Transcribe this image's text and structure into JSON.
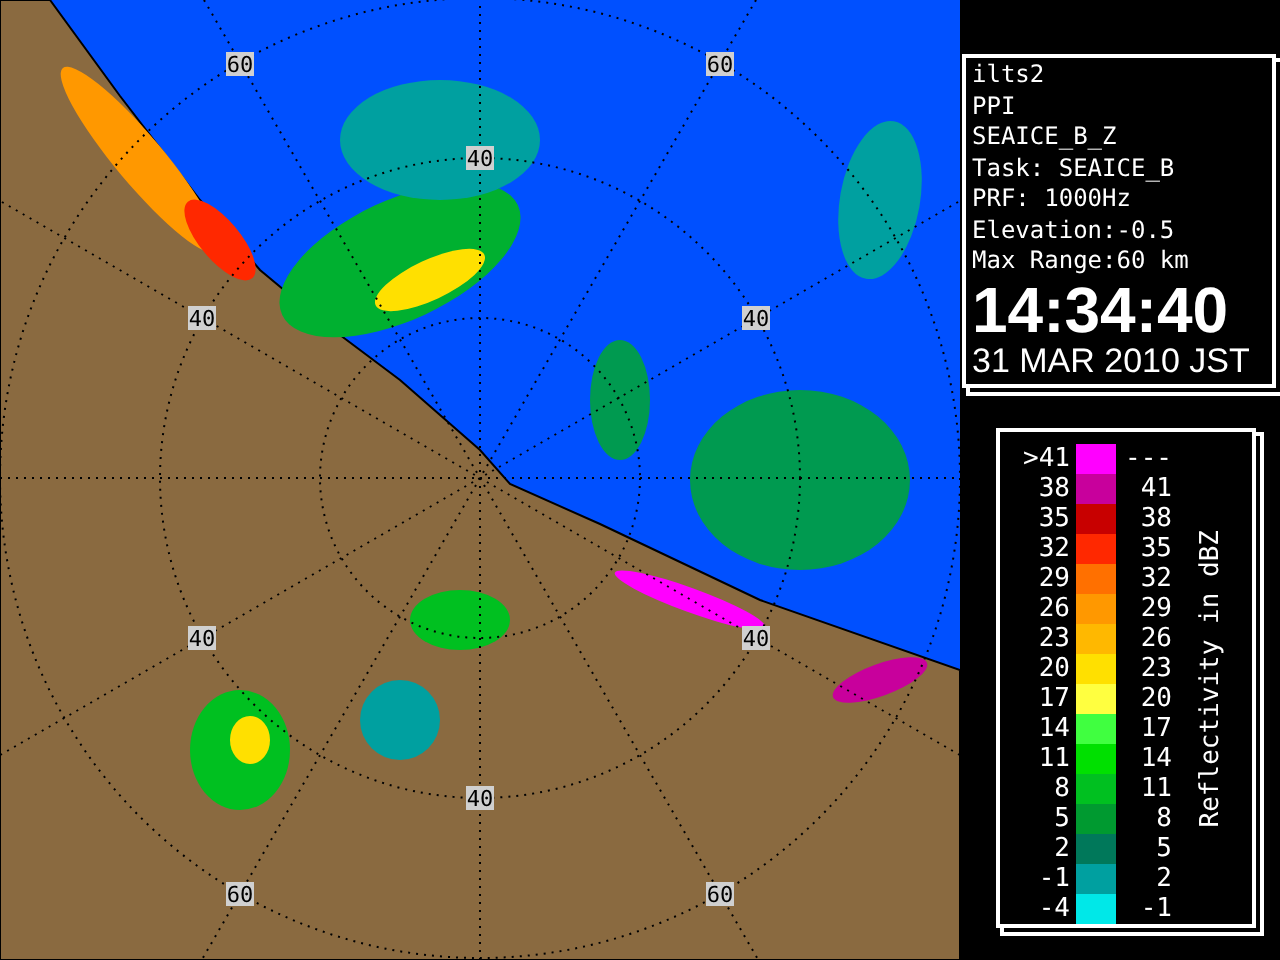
{
  "radar_map": {
    "range_labels": [
      {
        "text": "60"
      },
      {
        "text": "60"
      },
      {
        "text": "40"
      },
      {
        "text": "40"
      },
      {
        "text": "40"
      },
      {
        "text": "40"
      },
      {
        "text": "40"
      },
      {
        "text": "40"
      },
      {
        "text": "60"
      },
      {
        "text": "60"
      }
    ]
  },
  "info": {
    "station": "ilts2",
    "scan_mode": "PPI",
    "product": "SEAICE_B_Z",
    "task": "Task: SEAICE_B",
    "prf": "PRF: 1000Hz",
    "elevation": "Elevation:-0.5",
    "max_range": "Max Range:60 km",
    "time": "14:34:40",
    "date": "31 MAR 2010 JST"
  },
  "legend": {
    "title": "Reflectivity in dBZ",
    "bins": [
      {
        "low": ">41",
        "high": "---",
        "color": "#ff00ff"
      },
      {
        "low": "38",
        "high": "41",
        "color": "#c8009c"
      },
      {
        "low": "35",
        "high": "38",
        "color": "#c80000"
      },
      {
        "low": "32",
        "high": "35",
        "color": "#ff2800"
      },
      {
        "low": "29",
        "high": "32",
        "color": "#ff7000"
      },
      {
        "low": "26",
        "high": "29",
        "color": "#ff9800"
      },
      {
        "low": "23",
        "high": "26",
        "color": "#ffb800"
      },
      {
        "low": "20",
        "high": "23",
        "color": "#ffe000"
      },
      {
        "low": "17",
        "high": "20",
        "color": "#ffff40"
      },
      {
        "low": "14",
        "high": "17",
        "color": "#40ff40"
      },
      {
        "low": "11",
        "high": "14",
        "color": "#00e000"
      },
      {
        "low": "8",
        "high": "11",
        "color": "#00c020"
      },
      {
        "low": "5",
        "high": "8",
        "color": "#009a30"
      },
      {
        "low": "2",
        "high": "5",
        "color": "#00785a"
      },
      {
        "low": "-1",
        "high": "2",
        "color": "#00a0a0"
      },
      {
        "low": "-4",
        "high": "-1",
        "color": "#00e8e8"
      }
    ]
  }
}
